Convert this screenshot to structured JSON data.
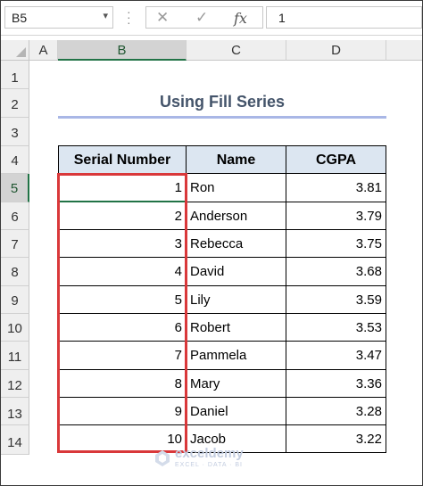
{
  "formula_bar": {
    "name_box": "B5",
    "cancel_icon": "✕",
    "enter_icon": "✓",
    "fx_label": "fx",
    "formula_value": "1"
  },
  "columns": [
    "A",
    "B",
    "C",
    "D"
  ],
  "rows": [
    "1",
    "2",
    "3",
    "4",
    "5",
    "6",
    "7",
    "8",
    "9",
    "10",
    "11",
    "12",
    "13",
    "14"
  ],
  "sheet": {
    "title": "Using Fill Series",
    "headers": [
      "Serial Number",
      "Name",
      "CGPA"
    ],
    "records": [
      {
        "serial": "1",
        "name": "Ron",
        "cgpa": "3.81"
      },
      {
        "serial": "2",
        "name": "Anderson",
        "cgpa": "3.79"
      },
      {
        "serial": "3",
        "name": "Rebecca",
        "cgpa": "3.75"
      },
      {
        "serial": "4",
        "name": "David",
        "cgpa": "3.68"
      },
      {
        "serial": "5",
        "name": "Lily",
        "cgpa": "3.59"
      },
      {
        "serial": "6",
        "name": "Robert",
        "cgpa": "3.53"
      },
      {
        "serial": "7",
        "name": "Pammela",
        "cgpa": "3.47"
      },
      {
        "serial": "8",
        "name": "Mary",
        "cgpa": "3.36"
      },
      {
        "serial": "9",
        "name": "Daniel",
        "cgpa": "3.28"
      },
      {
        "serial": "10",
        "name": "Jacob",
        "cgpa": "3.22"
      }
    ]
  },
  "watermark": {
    "name": "exceldemy",
    "tagline": "EXCEL · DATA · BI"
  },
  "colors": {
    "selection_green": "#217346",
    "highlight_red": "#d9383a",
    "header_fill": "#dce6f1",
    "title_color": "#44546a"
  }
}
